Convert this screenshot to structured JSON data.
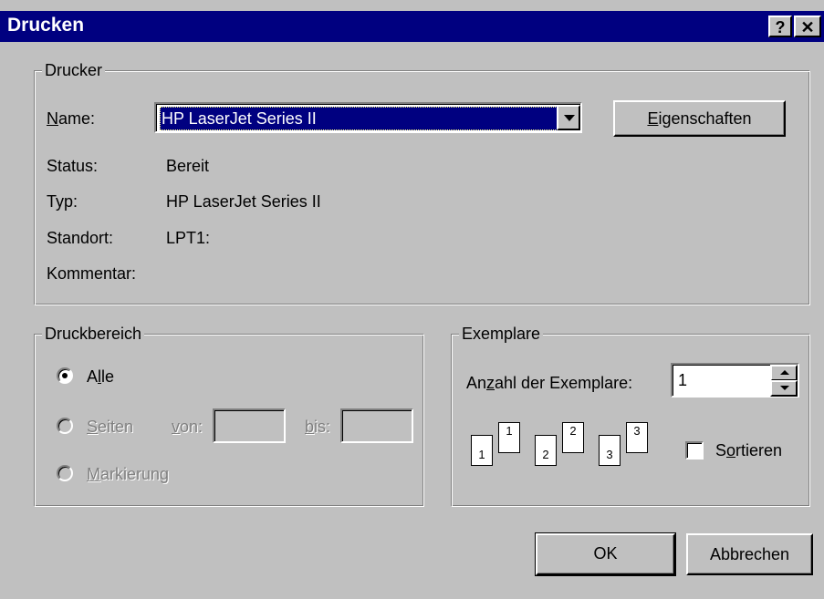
{
  "window": {
    "title": "Drucken",
    "help_button": "?",
    "close_button": "✕"
  },
  "printer_group": {
    "legend": "Drucker",
    "name_label": "Name:",
    "name_value": "HP LaserJet Series II",
    "properties_button": "Eigenschaften",
    "status_label": "Status:",
    "status_value": "Bereit",
    "type_label": "Typ:",
    "type_value": "HP LaserJet Series II",
    "location_label": "Standort:",
    "location_value": "LPT1:",
    "comment_label": "Kommentar:"
  },
  "range_group": {
    "legend": "Druckbereich",
    "all_label": "Alle",
    "pages_label": "Seiten",
    "from_label": "von:",
    "to_label": "bis:",
    "selection_label": "Markierung",
    "selected": "Alle"
  },
  "copies_group": {
    "legend": "Exemplare",
    "count_label": "Anzahl der Exemplare:",
    "count_value": "1",
    "collate_label": "Sortieren",
    "collate_checked": false,
    "collate_pages": [
      "1",
      "1",
      "2",
      "2",
      "3",
      "3"
    ]
  },
  "buttons": {
    "ok": "OK",
    "cancel": "Abbrechen"
  },
  "colors": {
    "title_bar": "#000080",
    "face": "#c0c0c0",
    "selection": "#000080"
  }
}
